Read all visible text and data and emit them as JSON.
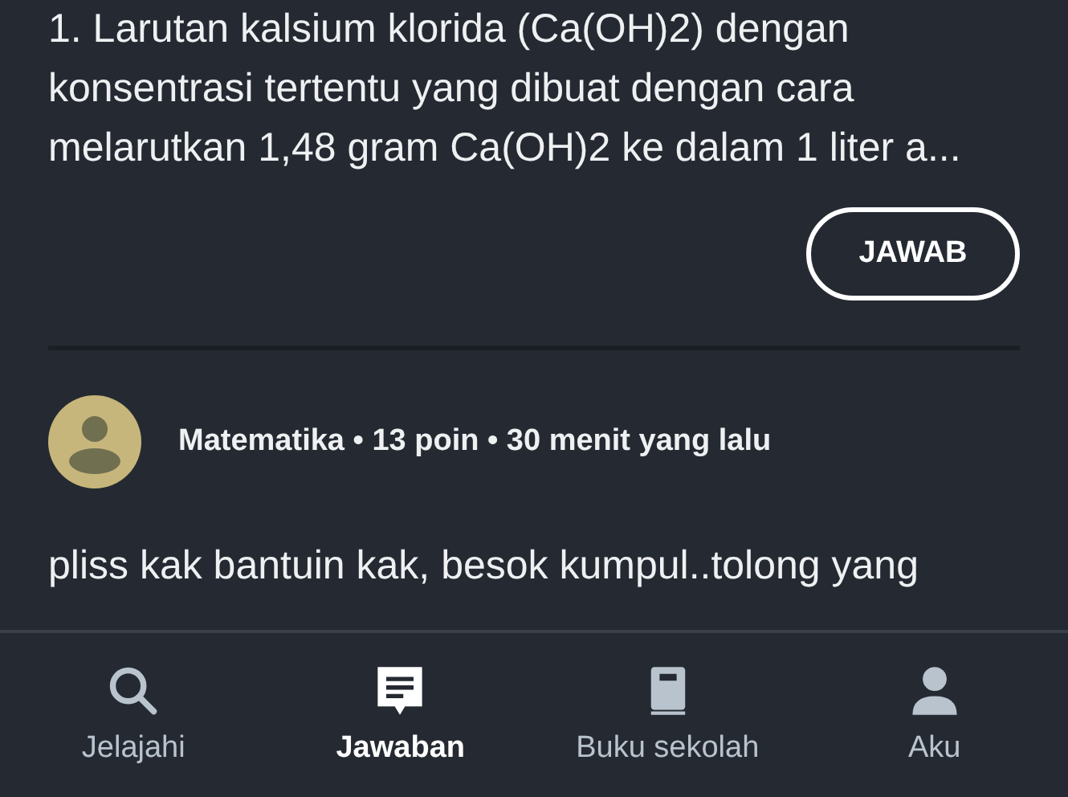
{
  "question": {
    "text": "1. Larutan kalsium klorida (Ca(OH)2) dengan konsentrasi tertentu yang dibuat dengan cara melarutkan 1,48 gram Ca(OH)2 ke dalam 1 liter a...",
    "button": "JAWAB"
  },
  "post": {
    "meta": "Matematika • 13 poin • 30 menit yang lalu",
    "text": "pliss kak bantuin kak, besok kumpul..tolong yang"
  },
  "nav": [
    {
      "label": "Jelajahi",
      "kind": "search",
      "selected": false
    },
    {
      "label": "Jawaban",
      "kind": "answers",
      "selected": true
    },
    {
      "label": "Buku sekolah",
      "kind": "book",
      "selected": false
    },
    {
      "label": "Aku",
      "kind": "profile",
      "selected": false
    }
  ]
}
